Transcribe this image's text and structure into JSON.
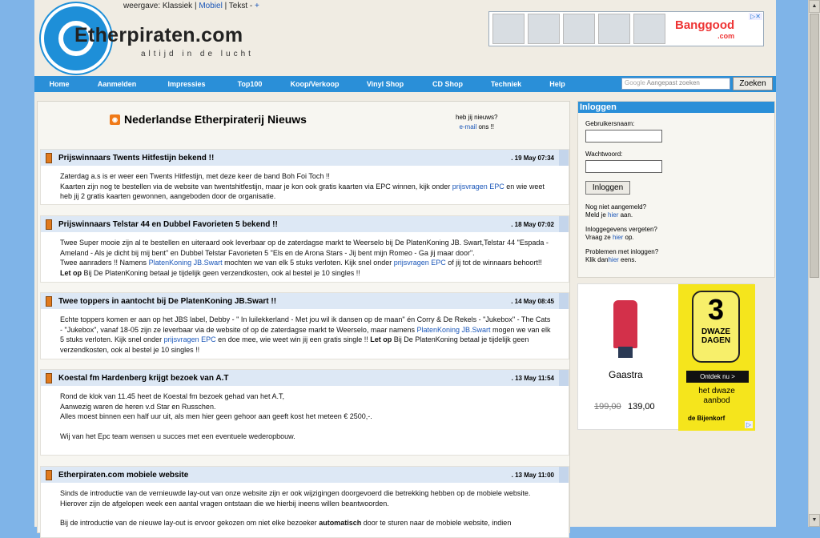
{
  "header": {
    "logo_text": "Etherpiraten.com",
    "tagline": "altijd in de lucht",
    "view_label": "weergave:",
    "view_classic": "Klassiek",
    "view_mobile": "Mobiel",
    "view_text": "Tekst",
    "view_plus": "+",
    "ad_brand": "Banggood",
    "ad_brand_sub": ".com"
  },
  "nav": {
    "items": [
      "Home",
      "Aanmelden",
      "Impressies",
      "Top100",
      "Koop/Verkoop",
      "Vinyl Shop",
      "CD Shop",
      "Techniek",
      "Help"
    ],
    "search_placeholder": "Aangepast zoeken",
    "search_button": "Zoeken"
  },
  "news": {
    "heading": "Nederlandse Etherpiraterij Nieuws",
    "tip_line1": "heb jij nieuws?",
    "tip_link": "e-mail",
    "tip_suffix": "ons !!",
    "items": [
      {
        "title": "Prijswinnaars Twents Hitfestijn bekend !!",
        "date": ". 19 May 07:34",
        "p1": "Zaterdag a.s is er weer een Twents Hitfestijn, met deze keer de band Boh Foi Toch !!",
        "p2a": "Kaarten zijn nog te bestellen via de website van twentshitfestijn, maar je kon ook gratis kaarten via EPC winnen, kijk onder ",
        "p2link": "prijsvragen EPC",
        "p2b": " en wie weet heb jij 2 gratis kaarten gewonnen, aangeboden door de organisatie."
      },
      {
        "title": "Prijswinnaars Telstar 44 en Dubbel Favorieten 5 bekend !!",
        "date": ". 18 May 07:02",
        "p1": "Twee Super mooie zijn al te bestellen en uiteraard ook leverbaar op de zaterdagse markt te Weerselo bij De PlatenKoning JB. Swart,Telstar 44 \"Espada - Ameland - Als je dicht bij mij bent\" en Dubbel Telstar Favorieten 5 \"Els en de Arona Stars - Jij bent mijn Romeo - Ga jij maar door\".",
        "p2a": "Twee aanraders !! Namens ",
        "p2link1": "PlatenKoning JB.Swart",
        "p2b": " mochten we van elk 5 stuks verloten. Kijk snel onder ",
        "p2link2": "prijsvragen EPC",
        "p2c": " of jij tot de winnaars behoort!! ",
        "p2bold": "Let op",
        "p2d": " Bij De PlatenKoning betaal je tijdelijk geen verzendkosten, ook al bestel je 10 singles !!"
      },
      {
        "title": "Twee toppers in aantocht bij De PlatenKoning JB.Swart !!",
        "date": ". 14 May 08:45",
        "p1a": "Echte toppers komen er aan op het JBS label, Debby - \" In luilekkerland - Met jou wil ik dansen op de maan\" én Corry & De Rekels - \"Jukebox\" - The Cats - \"Jukebox\", vanaf 18-05 zijn ze leverbaar via de website of op de zaterdagse markt te Weerselo, maar namens ",
        "p1link1": "PlatenKoning JB.Swart",
        "p1b": " mogen we van elk 5 stuks verloten. Kijk snel onder ",
        "p1link2": "prijsvragen EPC",
        "p1c": " en doe mee, wie weet win jij een gratis single !! ",
        "p1bold": "Let op",
        "p1d": " Bij De PlatenKoning betaal je tijdelijk geen verzendkosten, ook al bestel je 10 singles !!"
      },
      {
        "title": "Koestal fm Hardenberg krijgt bezoek van A.T",
        "date": ". 13 May 11:54",
        "l1": "Rond de klok van 11.45 heet de Koestal fm bezoek gehad van het A.T,",
        "l2": "Aanwezig waren de heren v.d Star en Russchen.",
        "l3": "Alles moest binnen een half uur uit, als men hier geen gehoor aan geeft kost het meteen € 2500,-.",
        "l4": "Wij van het Epc team wensen u succes met een eventuele wederopbouw."
      },
      {
        "title": "Etherpiraten.com mobiele website",
        "date": ". 13 May 11:00",
        "l1": "Sinds de introductie van de vernieuwde lay-out van onze website zijn er ook wijzigingen doorgevoerd die betrekking hebben op de mobiele website.",
        "l2": "Hierover zijn de afgelopen week een aantal vragen ontstaan die we hierbij ineens willen beantwoorden.",
        "l3a": "Bij de introductie van de nieuwe lay-out is ervoor gekozen om niet elke bezoeker ",
        "l3bold": "automatisch",
        "l3b": " door te sturen naar de mobiele website, indien"
      }
    ]
  },
  "login": {
    "heading": "Inloggen",
    "username_label": "Gebruikersnaam:",
    "password_label": "Wachtwoord:",
    "button": "Inloggen",
    "q1": "Nog niet aangemeld?",
    "q1a": "Meld je ",
    "q1link": "hier",
    "q1b": " aan.",
    "q2": "Inloggegevens vergeten?",
    "q2a": "Vraag ze ",
    "q2link": "hier",
    "q2b": " op.",
    "q3": "Problemen met inloggen?",
    "q3a": "Klik dan",
    "q3link": "hier",
    "q3b": " eens."
  },
  "ad2": {
    "product": "Gaastra",
    "old_price": "199,00",
    "new_price": "139,00",
    "big_number": "3",
    "dwaze": "DWAZE",
    "dagen": "DAGEN",
    "cta": "Ontdek nu >",
    "line1": "het dwaze",
    "line2": "aanbod",
    "store": "de Bijenkorf"
  }
}
